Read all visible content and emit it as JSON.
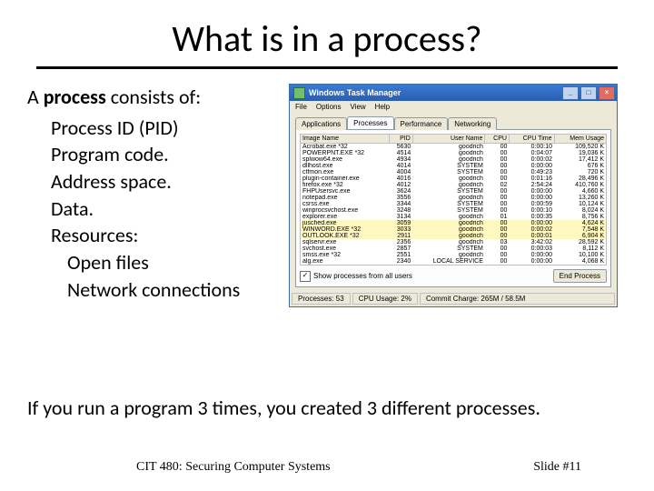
{
  "title": "What is in a process?",
  "lead_prefix": "A ",
  "lead_bold": "process",
  "lead_suffix": " consists of:",
  "bullets_l1": [
    "Process ID (PID)",
    "Program code.",
    "Address space.",
    "Data.",
    "Resources:"
  ],
  "bullets_l2": [
    "Open files",
    "Network connections"
  ],
  "bottom_line": "If you run a program 3 times, you created 3 different processes.",
  "footer_left": "CIT 480: Securing Computer Systems",
  "footer_right": "Slide #11",
  "tm": {
    "title": "Windows Task Manager",
    "menus": [
      "File",
      "Options",
      "View",
      "Help"
    ],
    "tabs": [
      "Applications",
      "Processes",
      "Performance",
      "Networking"
    ],
    "active_tab": "Processes",
    "columns": [
      "Image Name",
      "PID",
      "User Name",
      "CPU",
      "CPU Time",
      "Mem Usage"
    ],
    "rows": [
      [
        "Acrobat.exe *32",
        "5630",
        "goodrich",
        "00",
        "0:00:10",
        "109,520 K"
      ],
      [
        "POWERPNT.EXE *32",
        "4514",
        "goodrich",
        "00",
        "0:04:07",
        "19,036 K"
      ],
      [
        "splwow64.exe",
        "4934",
        "goodrich",
        "00",
        "0:00:02",
        "17,412 K"
      ],
      [
        "dllhost.exe",
        "4014",
        "SYSTEM",
        "00",
        "0:00:00",
        "676 K"
      ],
      [
        "ctfmon.exe",
        "4004",
        "SYSTEM",
        "00",
        "0:49:23",
        "720 K"
      ],
      [
        "plugin-container.exe",
        "4016",
        "goodrich",
        "00",
        "0:01:16",
        "28,496 K"
      ],
      [
        "firefox.exe *32",
        "4012",
        "goodrich",
        "02",
        "2:54:24",
        "410,760 K"
      ],
      [
        "FHPUsersvc.exe",
        "3624",
        "SYSTEM",
        "00",
        "0:00:00",
        "4,660 K"
      ],
      [
        "notepad.exe",
        "3556",
        "goodrich",
        "00",
        "0:00:00",
        "13,260 K"
      ],
      [
        "csrss.exe",
        "3344",
        "SYSTEM",
        "00",
        "0:00:59",
        "10,124 K"
      ],
      [
        "winprocsvchost.exe",
        "3248",
        "SYSTEM",
        "00",
        "0:00:10",
        "8,024 K"
      ],
      [
        "explorer.exe",
        "3134",
        "goodrich",
        "01",
        "0:00:35",
        "8,756 K"
      ],
      [
        "jusched.exe",
        "3059",
        "goodrich",
        "00",
        "0:00:00",
        "4,624 K"
      ],
      [
        "WINWORD.EXE *32",
        "3033",
        "goodrich",
        "00",
        "0:00:02",
        "7,548 K"
      ],
      [
        "OUTLOOK.EXE *32",
        "2911",
        "goodrich",
        "00",
        "0:00:01",
        "6,904 K"
      ],
      [
        "sqlservr.exe",
        "2356",
        "goodrich",
        "03",
        "3:42:02",
        "28,592 K"
      ],
      [
        "svchost.exe",
        "2857",
        "SYSTEM",
        "00",
        "0:00:03",
        "8,112 K"
      ],
      [
        "smss.exe *32",
        "2551",
        "goodrich",
        "00",
        "0:00:00",
        "10,100 K"
      ],
      [
        "alg.exe",
        "2340",
        "LOCAL SERVICE",
        "00",
        "0:00:00",
        "4,068 K"
      ]
    ],
    "selected_rows": [
      12,
      13,
      14
    ],
    "checkbox_label": "Show processes from all users",
    "end_process": "End Process",
    "status": {
      "processes": "Processes: 53",
      "cpu": "CPU Usage: 2%",
      "commit": "Commit Charge: 265M / 58.5M"
    }
  }
}
